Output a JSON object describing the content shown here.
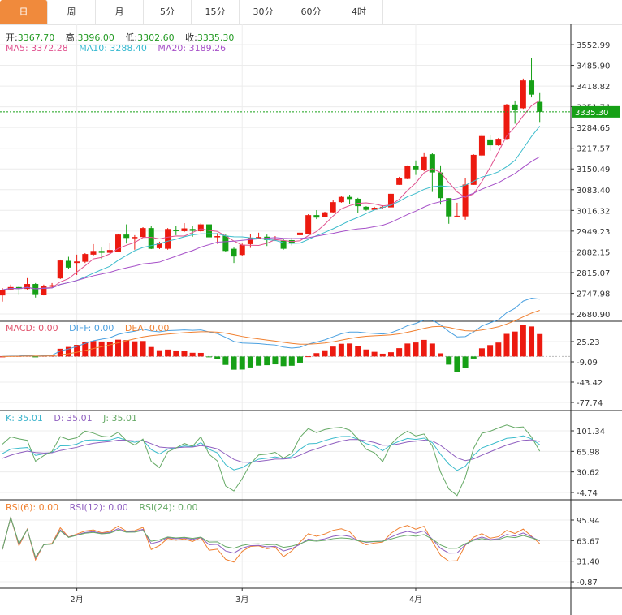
{
  "tabs": [
    {
      "label": "日",
      "active": true
    },
    {
      "label": "周"
    },
    {
      "label": "月"
    },
    {
      "label": "5分"
    },
    {
      "label": "15分"
    },
    {
      "label": "30分"
    },
    {
      "label": "60分"
    },
    {
      "label": "4时"
    }
  ],
  "ohlc_legend": {
    "open_label": "开:",
    "open": "3367.70",
    "high_label": "高:",
    "high": "3396.00",
    "low_label": "低:",
    "low": "3302.60",
    "close_label": "收:",
    "close": "3335.30"
  },
  "ma_legend": {
    "ma5": "MA5: 3372.28",
    "ma10": "MA10: 3288.40",
    "ma20": "MA20: 3189.26"
  },
  "macd_legend": {
    "macd": "MACD: 0.00",
    "diff": "DIFF: 0.00",
    "dea": "DEA: 0.00"
  },
  "kdj_legend": {
    "k": "K: 35.01",
    "d": "D: 35.01",
    "j": "J: 35.01"
  },
  "rsi_legend": {
    "rsi6": "RSI(6): 0.00",
    "rsi12": "RSI(12): 0.00",
    "rsi24": "RSI(24): 0.00"
  },
  "current_price": "3335.30",
  "colors": {
    "up": "#ec1a10",
    "down": "#16a016",
    "tab_active": "#f08a3c",
    "ma5": "#e0508e",
    "ma10": "#3cbccc",
    "ma20": "#a650c8",
    "diff": "#4aa0e0",
    "dea": "#f08030",
    "k": "#3cbccc",
    "d": "#9060c0",
    "j": "#66aa66",
    "rsi6": "#f08030",
    "rsi12": "#9060c0",
    "rsi24": "#66aa66",
    "price_tag": "#16a016"
  },
  "chart_data": {
    "type": "candlestick",
    "fields": [
      "open",
      "high",
      "low",
      "close"
    ],
    "ohlc": [
      [
        2741,
        2765,
        2721,
        2759
      ],
      [
        2760,
        2776,
        2757,
        2768
      ],
      [
        2768,
        2770,
        2745,
        2762
      ],
      [
        2762,
        2797,
        2760,
        2778
      ],
      [
        2778,
        2781,
        2734,
        2745
      ],
      [
        2743,
        2776,
        2741,
        2772
      ],
      [
        2769,
        2781,
        2768,
        2774
      ],
      [
        2796,
        2857,
        2794,
        2854
      ],
      [
        2853,
        2866,
        2828,
        2831
      ],
      [
        2846,
        2873,
        2807,
        2851
      ],
      [
        2850,
        2878,
        2846,
        2875
      ],
      [
        2873,
        2907,
        2870,
        2885
      ],
      [
        2885,
        2896,
        2859,
        2879
      ],
      [
        2879,
        2911,
        2878,
        2888
      ],
      [
        2883,
        2941,
        2881,
        2938
      ],
      [
        2938,
        2971,
        2909,
        2927
      ],
      [
        2926,
        2936,
        2889,
        2930
      ],
      [
        2930,
        2962,
        2928,
        2959
      ],
      [
        2959,
        2967,
        2891,
        2892
      ],
      [
        2894,
        2915,
        2891,
        2911
      ],
      [
        2892,
        2959,
        2889,
        2956
      ],
      [
        2953,
        2967,
        2936,
        2949
      ],
      [
        2949,
        2975,
        2946,
        2958
      ],
      [
        2956,
        2966,
        2931,
        2950
      ],
      [
        2949,
        2975,
        2946,
        2971
      ],
      [
        2971,
        2975,
        2901,
        2929
      ],
      [
        2929,
        2943,
        2908,
        2933
      ],
      [
        2934,
        2938,
        2883,
        2885
      ],
      [
        2892,
        2896,
        2846,
        2867
      ],
      [
        2872,
        2909,
        2870,
        2905
      ],
      [
        2907,
        2940,
        2895,
        2927
      ],
      [
        2925,
        2944,
        2923,
        2930
      ],
      [
        2931,
        2938,
        2901,
        2920
      ],
      [
        2922,
        2933,
        2917,
        2925
      ],
      [
        2918,
        2923,
        2889,
        2892
      ],
      [
        2920,
        2928,
        2903,
        2909
      ],
      [
        2936,
        2949,
        2931,
        2944
      ],
      [
        2940,
        3004,
        2938,
        3001
      ],
      [
        3001,
        3017,
        2988,
        2993
      ],
      [
        2995,
        3012,
        2994,
        3010
      ],
      [
        3010,
        3049,
        3007,
        3043
      ],
      [
        3043,
        3064,
        3041,
        3060
      ],
      [
        3060,
        3067,
        3036,
        3053
      ],
      [
        3054,
        3057,
        3007,
        3030
      ],
      [
        3028,
        3030,
        3015,
        3018
      ],
      [
        3018,
        3028,
        3017,
        3025
      ],
      [
        3026,
        3033,
        3022,
        3028
      ],
      [
        3026,
        3072,
        3025,
        3070
      ],
      [
        3099,
        3125,
        3099,
        3120
      ],
      [
        3118,
        3162,
        3117,
        3159
      ],
      [
        3159,
        3178,
        3131,
        3149
      ],
      [
        3146,
        3204,
        3143,
        3191
      ],
      [
        3198,
        3201,
        3076,
        3139
      ],
      [
        3139,
        3162,
        3035,
        3056
      ],
      [
        3056,
        3056,
        2973,
        2997
      ],
      [
        2997,
        3041,
        2994,
        2999
      ],
      [
        2997,
        3120,
        2986,
        3100
      ],
      [
        3099,
        3198,
        3099,
        3196
      ],
      [
        3194,
        3264,
        3190,
        3257
      ],
      [
        3246,
        3261,
        3209,
        3227
      ],
      [
        3227,
        3251,
        3225,
        3248
      ],
      [
        3248,
        3361,
        3246,
        3359
      ],
      [
        3359,
        3372,
        3297,
        3341
      ],
      [
        3347,
        3443,
        3345,
        3437
      ],
      [
        3437,
        3511,
        3382,
        3391
      ],
      [
        3367.7,
        3396.0,
        3302.6,
        3335.3
      ]
    ],
    "moving_averages": [
      "MA5",
      "MA10",
      "MA20"
    ],
    "x_ticks": [
      {
        "label": "2月",
        "index": 9
      },
      {
        "label": "3月",
        "index": 29
      },
      {
        "label": "4月",
        "index": 50
      }
    ],
    "price_axis": {
      "ticks": [
        "3552.99",
        "3485.90",
        "3418.82",
        "3351.74",
        "3284.65",
        "3217.57",
        "3150.49",
        "3083.40",
        "3016.32",
        "2949.23",
        "2882.15",
        "2815.07",
        "2747.98",
        "2680.90"
      ]
    },
    "macd_axis": {
      "ticks": [
        "25.23",
        "-9.09",
        "-43.42",
        "-77.74"
      ]
    },
    "kdj_axis": {
      "ticks": [
        "101.34",
        "65.98",
        "30.62",
        "-4.74"
      ]
    },
    "rsi_axis": {
      "ticks": [
        "95.94",
        "63.67",
        "31.40",
        "-0.87"
      ]
    },
    "grid": true
  }
}
